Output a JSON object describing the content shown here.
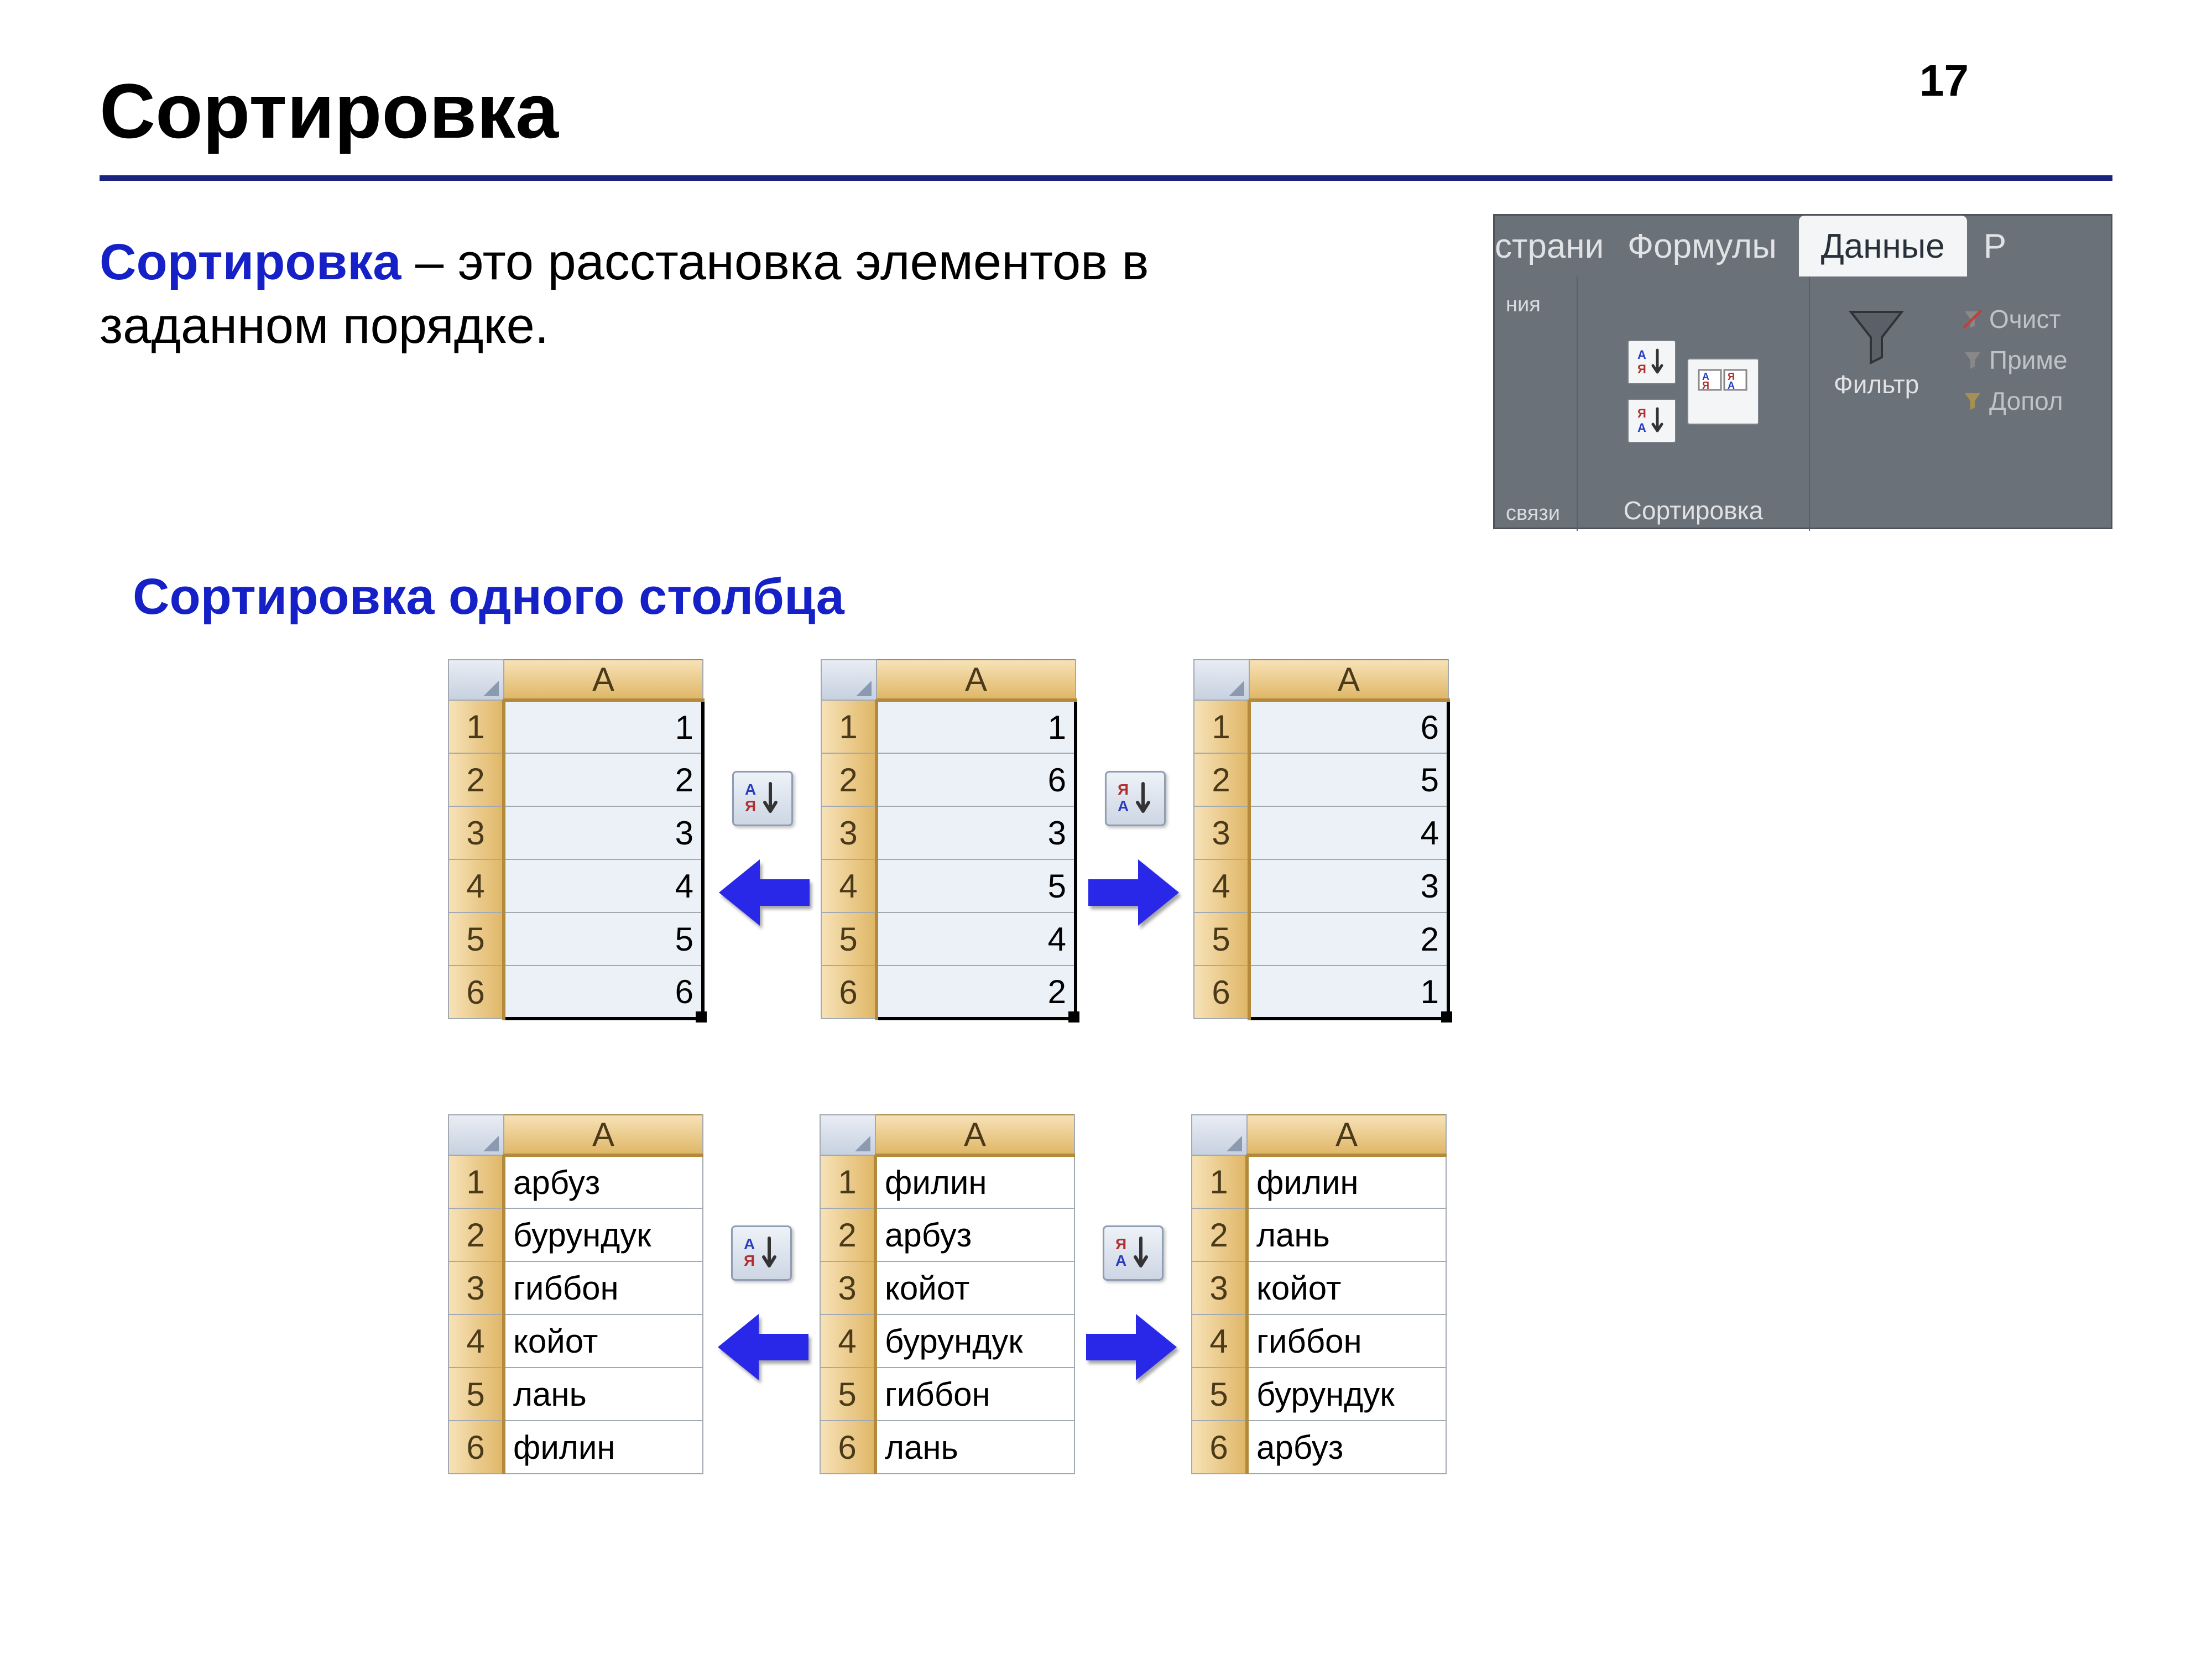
{
  "page_number": "17",
  "title": "Сортировка",
  "definition": {
    "term": "Сортировка",
    "rest": " – это расстановка элементов в заданном порядке."
  },
  "ribbon": {
    "tabs": {
      "t1": "страницы",
      "t2": "Формулы",
      "active": "Данные",
      "t3": "Ре"
    },
    "group_left_label": "ния",
    "group_left_sub": "связи",
    "sort_label": "Сортировка",
    "filter_label": "Фильтр",
    "filter_items": {
      "a": "Очист",
      "b": "Приме",
      "c": "Допол"
    }
  },
  "sub_heading": "Сортировка одного столбца",
  "col_header": "A",
  "rows": [
    "1",
    "2",
    "3",
    "4",
    "5",
    "6"
  ],
  "tables": {
    "num_asc": [
      "1",
      "2",
      "3",
      "4",
      "5",
      "6"
    ],
    "num_orig": [
      "1",
      "6",
      "3",
      "5",
      "4",
      "2"
    ],
    "num_desc": [
      "6",
      "5",
      "4",
      "3",
      "2",
      "1"
    ],
    "txt_asc": [
      "арбуз",
      "бурундук",
      "гиббон",
      "койот",
      "лань",
      "филин"
    ],
    "txt_orig": [
      "филин",
      "арбуз",
      "койот",
      "бурундук",
      "гиббон",
      "лань"
    ],
    "txt_desc": [
      "филин",
      "лань",
      "койот",
      "гиббон",
      "бурундук",
      "арбуз"
    ]
  },
  "icons": {
    "sort_asc": "А↓Я",
    "sort_desc": "Я↓А"
  }
}
